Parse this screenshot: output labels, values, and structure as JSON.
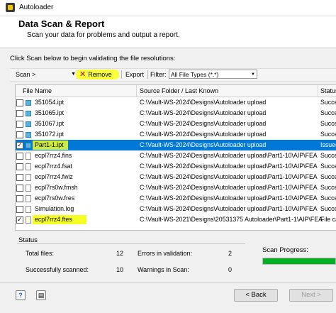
{
  "window": {
    "title": "Autoloader"
  },
  "header": {
    "title": "Data Scan & Report",
    "subtitle": "Scan your data for problems and output a report."
  },
  "instruction": "Click Scan below to begin validating the file resolutions:",
  "toolbar": {
    "scan_label": "Scan >",
    "remove_label": "Remove",
    "export_label": "Export",
    "filter_label": "Filter:",
    "filter_value": "All File Types (*.*)"
  },
  "table": {
    "columns": [
      "File Name",
      "Source Folder / Last Known",
      "Status"
    ],
    "rows": [
      {
        "name": "351054.ipt",
        "folder": "C:\\Vault-WS-2024\\Designs\\Autoloader upload",
        "status": "Succe",
        "checked": false,
        "selected": false,
        "icon": "part-icon"
      },
      {
        "name": "351065.ipt",
        "folder": "C:\\Vault-WS-2024\\Designs\\Autoloader upload",
        "status": "Succe",
        "checked": false,
        "selected": false,
        "icon": "part-icon"
      },
      {
        "name": "351067.ipt",
        "folder": "C:\\Vault-WS-2024\\Designs\\Autoloader upload",
        "status": "Succe",
        "checked": false,
        "selected": false,
        "icon": "part-icon"
      },
      {
        "name": "351072.ipt",
        "folder": "C:\\Vault-WS-2024\\Designs\\Autoloader upload",
        "status": "Succe",
        "checked": false,
        "selected": false,
        "icon": "part-icon"
      },
      {
        "name": "Part1-1.ipt",
        "folder": "C:\\Vault-WS-2024\\Designs\\Autoloader upload",
        "status": "Issue(",
        "checked": true,
        "selected": true,
        "icon": "part-icon"
      },
      {
        "name": "ecpl7rrz4.fins",
        "folder": "C:\\Vault-WS-2024\\Designs\\Autoloader upload\\Part1-10\\AIP\\FEA",
        "status": "Succe",
        "checked": false,
        "selected": false,
        "icon": "file-icon"
      },
      {
        "name": "ecpl7rrz4.fsat",
        "folder": "C:\\Vault-WS-2024\\Designs\\Autoloader upload\\Part1-10\\AIP\\FEA",
        "status": "Succe",
        "checked": false,
        "selected": false,
        "icon": "file-icon"
      },
      {
        "name": "ecpl7rrz4.fwiz",
        "folder": "C:\\Vault-WS-2024\\Designs\\Autoloader upload\\Part1-10\\AIP\\FEA",
        "status": "Succe",
        "checked": false,
        "selected": false,
        "icon": "file-icon"
      },
      {
        "name": "ecpl7rs0w.fmsh",
        "folder": "C:\\Vault-WS-2024\\Designs\\Autoloader upload\\Part1-10\\AIP\\FEA",
        "status": "Succe",
        "checked": false,
        "selected": false,
        "icon": "file-icon"
      },
      {
        "name": "ecpl7rs0w.fres",
        "folder": "C:\\Vault-WS-2024\\Designs\\Autoloader upload\\Part1-10\\AIP\\FEA",
        "status": "Succe",
        "checked": false,
        "selected": false,
        "icon": "file-icon"
      },
      {
        "name": "Simulation.log",
        "folder": "C:\\Vault-WS-2024\\Designs\\Autoloader upload\\Part1-10\\AIP\\FEA",
        "status": "Succe",
        "checked": false,
        "selected": false,
        "icon": "file-icon"
      },
      {
        "name": "ecpl7rrz4.ftes",
        "folder": "C:\\Vault-WS-2021\\Designs\\20531375 Autoloader\\Part1-1\\AIP\\FEA",
        "status": "File ca",
        "checked": true,
        "selected": false,
        "icon": "file-icon"
      }
    ]
  },
  "status": {
    "label": "Status",
    "total_files_label": "Total files:",
    "total_files": "12",
    "errors_label": "Errors in validation:",
    "errors": "2",
    "scanned_label": "Successfully scanned:",
    "scanned": "10",
    "warnings_label": "Warnings in Scan:",
    "warnings": "0"
  },
  "progress": {
    "label": "Scan Progress:",
    "fraction": 1.0,
    "color": "#06b025"
  },
  "footer": {
    "back_label": "< Back",
    "next_label": "Next >"
  },
  "colors": {
    "selection": "#0078d7",
    "highlight": "#f5ff24"
  }
}
